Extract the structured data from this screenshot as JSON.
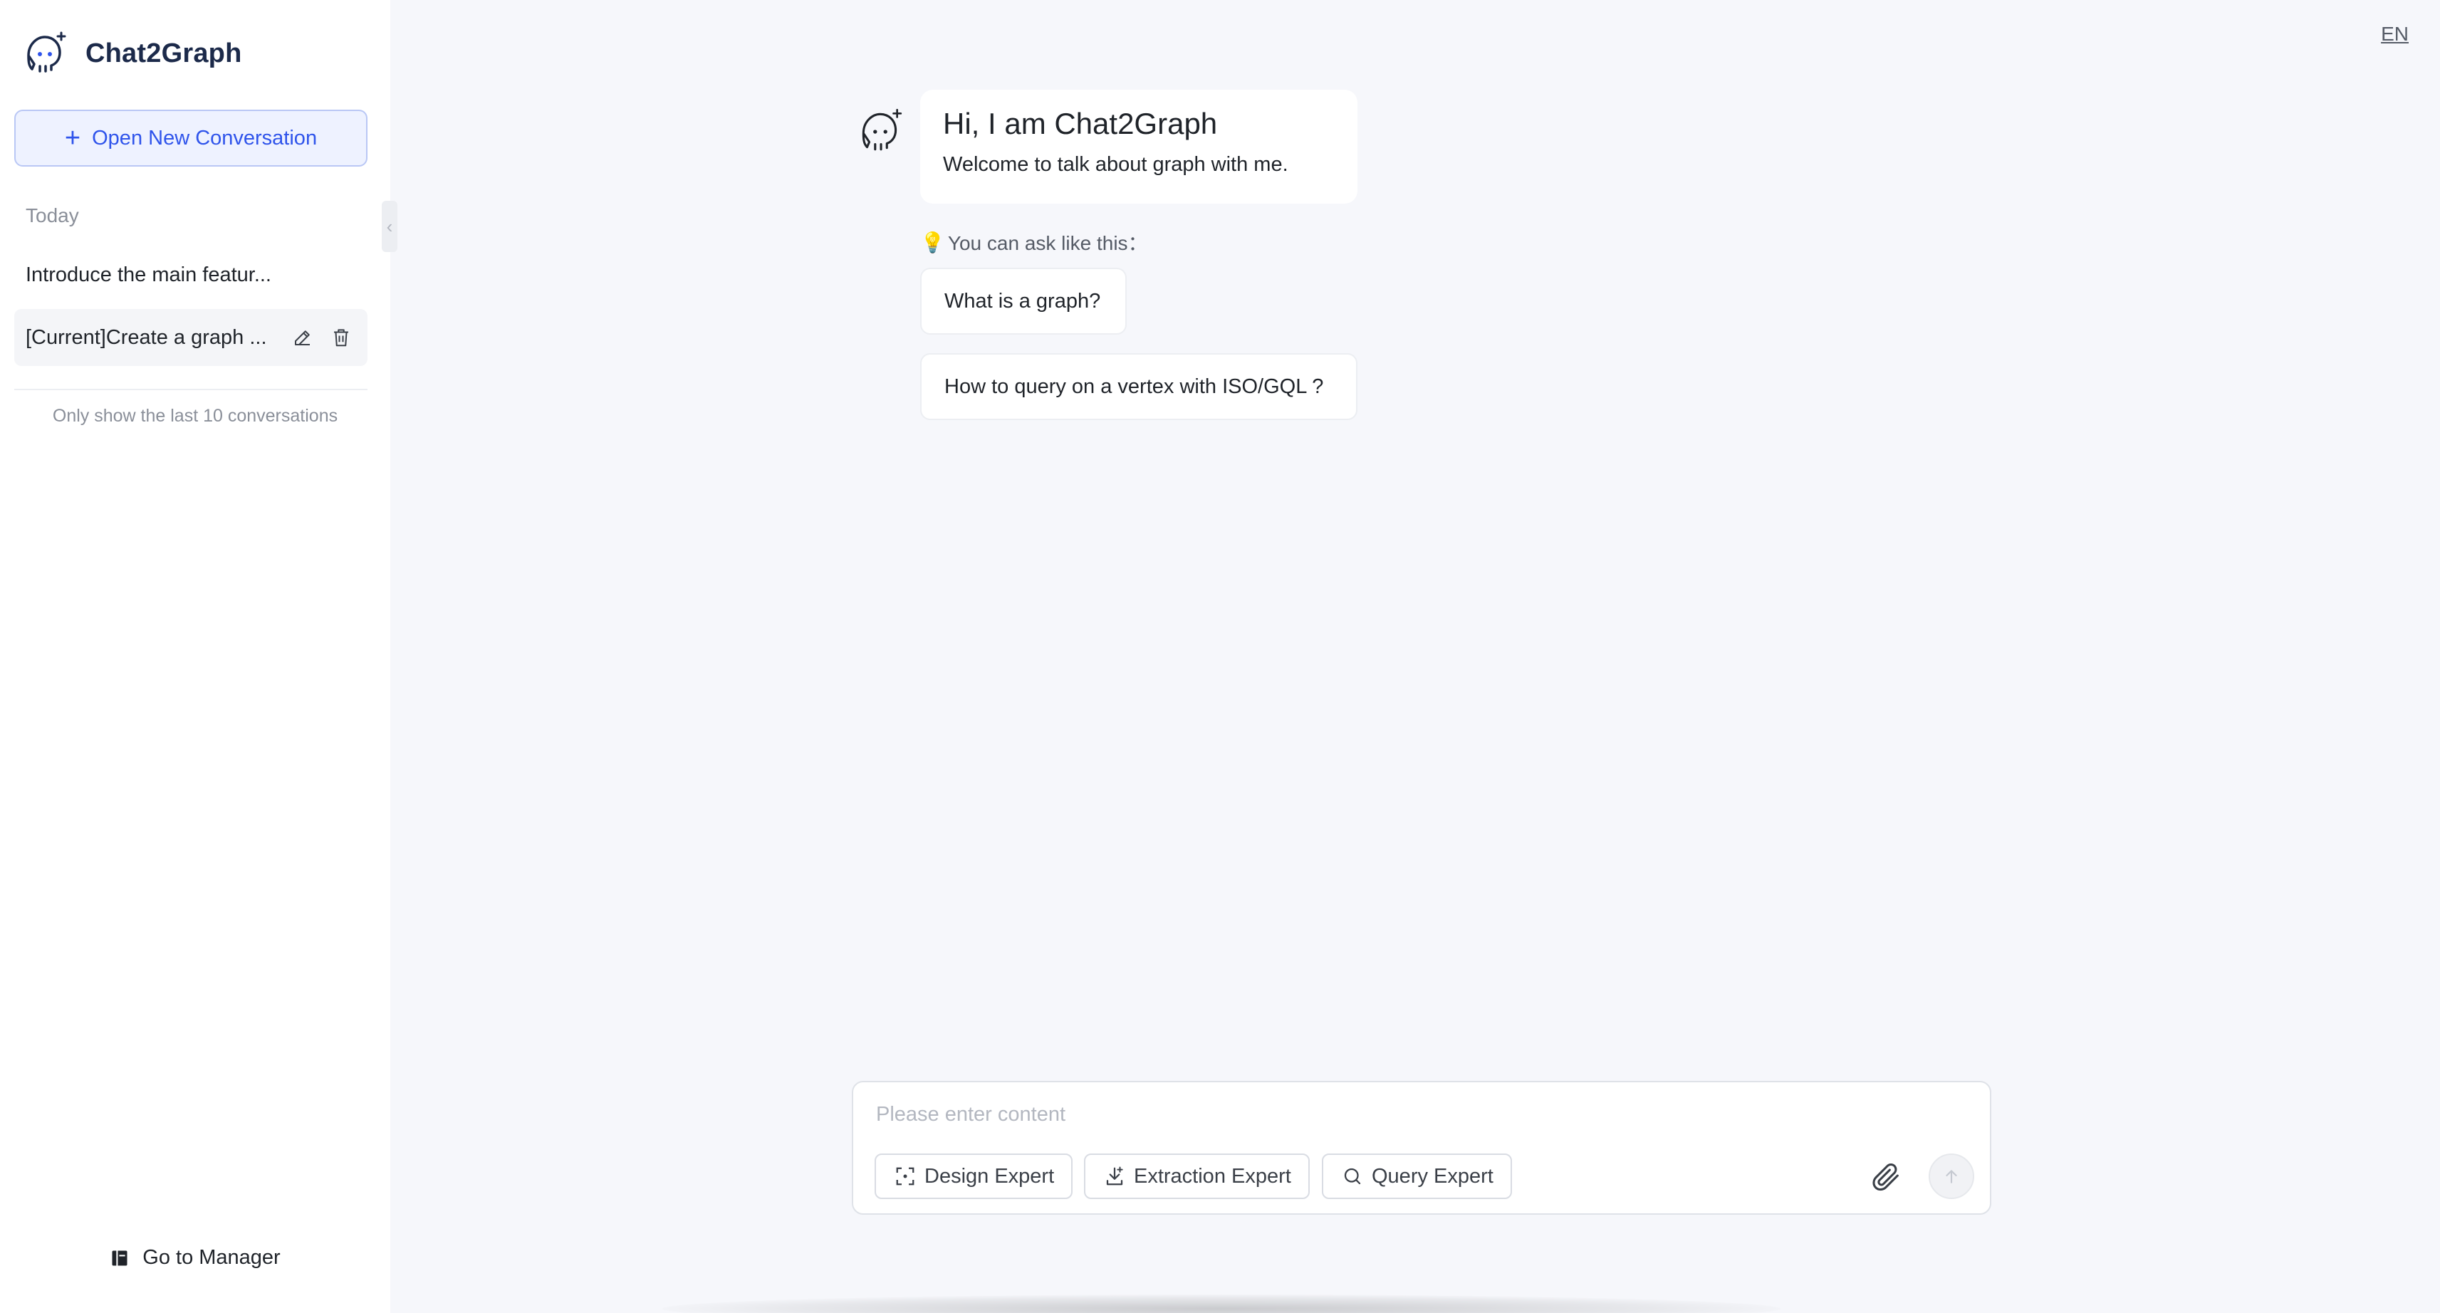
{
  "app": {
    "name": "Chat2Graph",
    "language": "EN"
  },
  "sidebar": {
    "new_conversation": "Open New Conversation",
    "section_today": "Today",
    "conversations": [
      {
        "label": "Introduce the main featur..."
      },
      {
        "label": "[Current]Create a graph ..."
      }
    ],
    "footer_note": "Only show the last 10 conversations",
    "go_to_manager": "Go to Manager"
  },
  "chat": {
    "welcome_title": "Hi, I am Chat2Graph",
    "welcome_sub": "Welcome to talk about graph with me.",
    "ask_hint": "You can ask like this：",
    "suggestions": [
      {
        "label": "What is a graph?"
      },
      {
        "label": "How to query on a vertex with ISO/GQL ?"
      }
    ]
  },
  "composer": {
    "placeholder": "Please enter content",
    "experts": [
      {
        "label": "Design Expert",
        "icon": "design-icon"
      },
      {
        "label": "Extraction Expert",
        "icon": "extraction-icon"
      },
      {
        "label": "Query Expert",
        "icon": "query-icon"
      }
    ]
  },
  "colors": {
    "accent": "#2f54eb",
    "brand_text": "#1c2a4a",
    "background": "#f6f7fb"
  }
}
